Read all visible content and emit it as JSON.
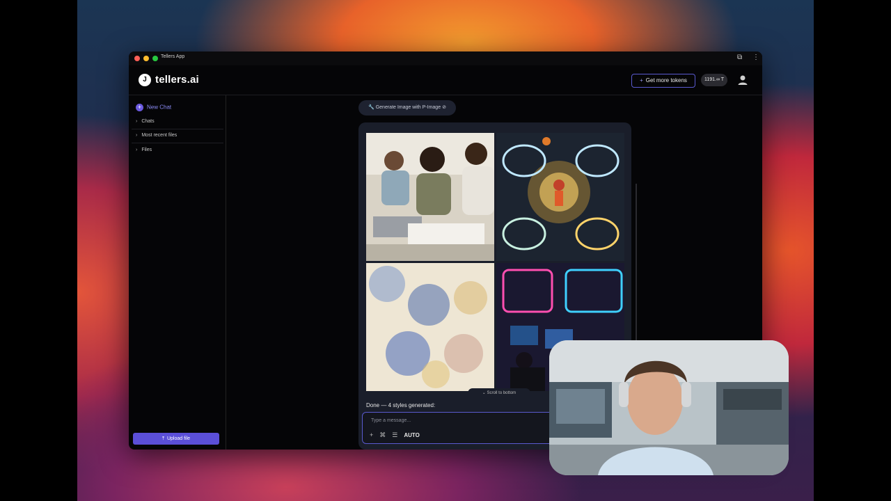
{
  "window": {
    "app_title": "Tellers App"
  },
  "header": {
    "logo_mark": "J",
    "logo_text": "tellers.ai",
    "get_tokens_label": "Get more tokens",
    "token_count": "1191.∞ T"
  },
  "sidebar": {
    "new_chat_label": "New Chat",
    "items": [
      {
        "label": "Chats"
      },
      {
        "label": "Most recent files"
      },
      {
        "label": "Files"
      }
    ],
    "upload_label": "Upload file"
  },
  "chat": {
    "tool_pill": "Generate Image with P-Image",
    "scroll_to_bottom": "Scroll to bottom",
    "status_text": "Done — 4 styles generated:",
    "input_placeholder": "Type a message...",
    "mode_label": "AUTO",
    "images": [
      {
        "style": "photo",
        "subject": "students-writing-at-laptops"
      },
      {
        "style": "glowing-illustration",
        "subject": "basketball-players"
      },
      {
        "style": "watercolor",
        "subject": "students-drawing"
      },
      {
        "style": "neon-futuristic",
        "subject": "students-at-computers"
      }
    ]
  },
  "icons": {
    "tool": "wrench-icon",
    "plus": "plus-icon",
    "expand": "expand-icon",
    "menu": "more-icon",
    "user": "user-icon"
  }
}
